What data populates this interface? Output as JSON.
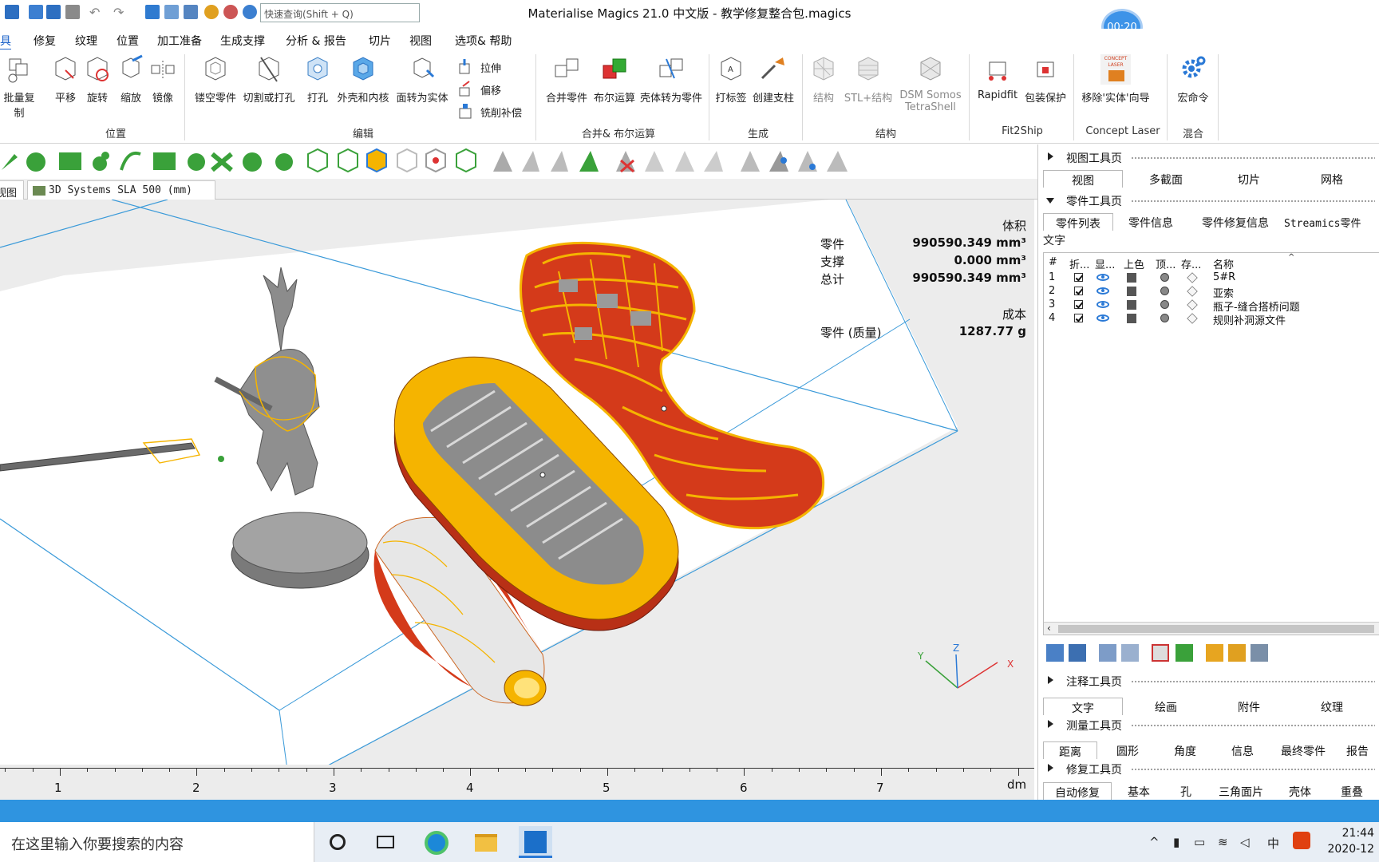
{
  "window": {
    "title": "Materialise Magics 21.0 中文版 - 教学修复整合包.magics",
    "search_placeholder": "快速查询(Shift + Q)",
    "timer": "00:20"
  },
  "menu": {
    "items": [
      "具",
      "修复",
      "纹理",
      "位置",
      "加工准备",
      "生成支撑",
      "分析 & 报告",
      "切片",
      "视图",
      "选项& 帮助"
    ]
  },
  "ribbon": {
    "buttons": {
      "batch_copy": "批量复制",
      "translate": "平移",
      "rotate": "旋转",
      "scale": "缩放",
      "mirror": "镜像",
      "hollow_part": "镂空零件",
      "cut_punch": "切割或打孔",
      "drill": "打孔",
      "shell_core": "外壳和内核",
      "face_to_solid": "面转为实体",
      "extrude": "拉伸",
      "offset": "偏移",
      "mill_comp": "铣削补偿",
      "merge_parts": "合并零件",
      "boolean": "布尔运算",
      "shell_to_part": "壳体转为零件",
      "label": "打标签",
      "create_support": "创建支柱",
      "structure": "结构",
      "stl_structure": "STL+结构",
      "dsm_line1": "DSM Somos",
      "dsm_line2": "TetraShell",
      "rapidfit": "Rapidfit",
      "pack_protect": "包装保护",
      "remove_solid": "移除'实体'向导",
      "macro": "宏命令"
    },
    "groups": {
      "position": "位置",
      "edit": "编辑",
      "merge_boolean": "合并& 布尔运算",
      "generate": "生成",
      "structure": "结构",
      "fit2ship": "Fit2Ship",
      "concept_laser": "Concept Laser",
      "mix": "混合",
      "concept_logo": "CONCEPT LASER"
    }
  },
  "doc_tabs": [
    "视图",
    "3D Systems SLA 500 (mm)"
  ],
  "viewport": {
    "volume_title": "体积",
    "rows": [
      {
        "label": "零件",
        "value": "990590.349 mm³"
      },
      {
        "label": "支撑",
        "value": "0.000 mm³"
      },
      {
        "label": "总计",
        "value": "990590.349 mm³"
      }
    ],
    "cost_title": "成本",
    "cost_row": {
      "label": "零件 (质量)",
      "value": "1287.77 g"
    },
    "axis_labels": {
      "x": "X",
      "y": "Y",
      "z": "Z"
    }
  },
  "ruler": {
    "labels": [
      "1",
      "2",
      "3",
      "4",
      "5",
      "6",
      "7"
    ],
    "unit": "dm"
  },
  "right_panel": {
    "view_tools": {
      "title": "视图工具页",
      "tabs": [
        "视图",
        "多截面",
        "切片",
        "网格"
      ]
    },
    "part_tools": {
      "title": "零件工具页",
      "tabs": [
        "零件列表",
        "零件信息",
        "零件修复信息",
        "Streamics零件"
      ],
      "text_label": "文字"
    },
    "table": {
      "headers": [
        "#",
        "折...",
        "显...",
        "上色",
        "顶...",
        "存...",
        "名称"
      ],
      "rows": [
        {
          "num": "1",
          "name": "5#R"
        },
        {
          "num": "2",
          "name": "亚索"
        },
        {
          "num": "3",
          "name": "瓶子-缝合搭桥问题"
        },
        {
          "num": "4",
          "name": "规则补洞源文件"
        }
      ]
    },
    "annotation_tools": {
      "title": "注释工具页",
      "tabs": [
        "文字",
        "绘画",
        "附件",
        "纹理"
      ]
    },
    "measure_tools": {
      "title": "测量工具页",
      "tabs": [
        "距离",
        "圆形",
        "角度",
        "信息",
        "最终零件",
        "报告"
      ]
    },
    "fix_tools": {
      "title": "修复工具页",
      "tabs": [
        "自动修复",
        "基本",
        "孔",
        "三角面片",
        "壳体",
        "重叠"
      ]
    }
  },
  "taskbar": {
    "search_text": "在这里输入你要搜索的内容",
    "ime": "中",
    "time": "21:44",
    "date": "2020-12"
  },
  "colors": {
    "accent": "#2f94e0",
    "part_yellow": "#f5b400",
    "part_red": "#d43a1a",
    "platform_line": "#3a9ad9"
  }
}
